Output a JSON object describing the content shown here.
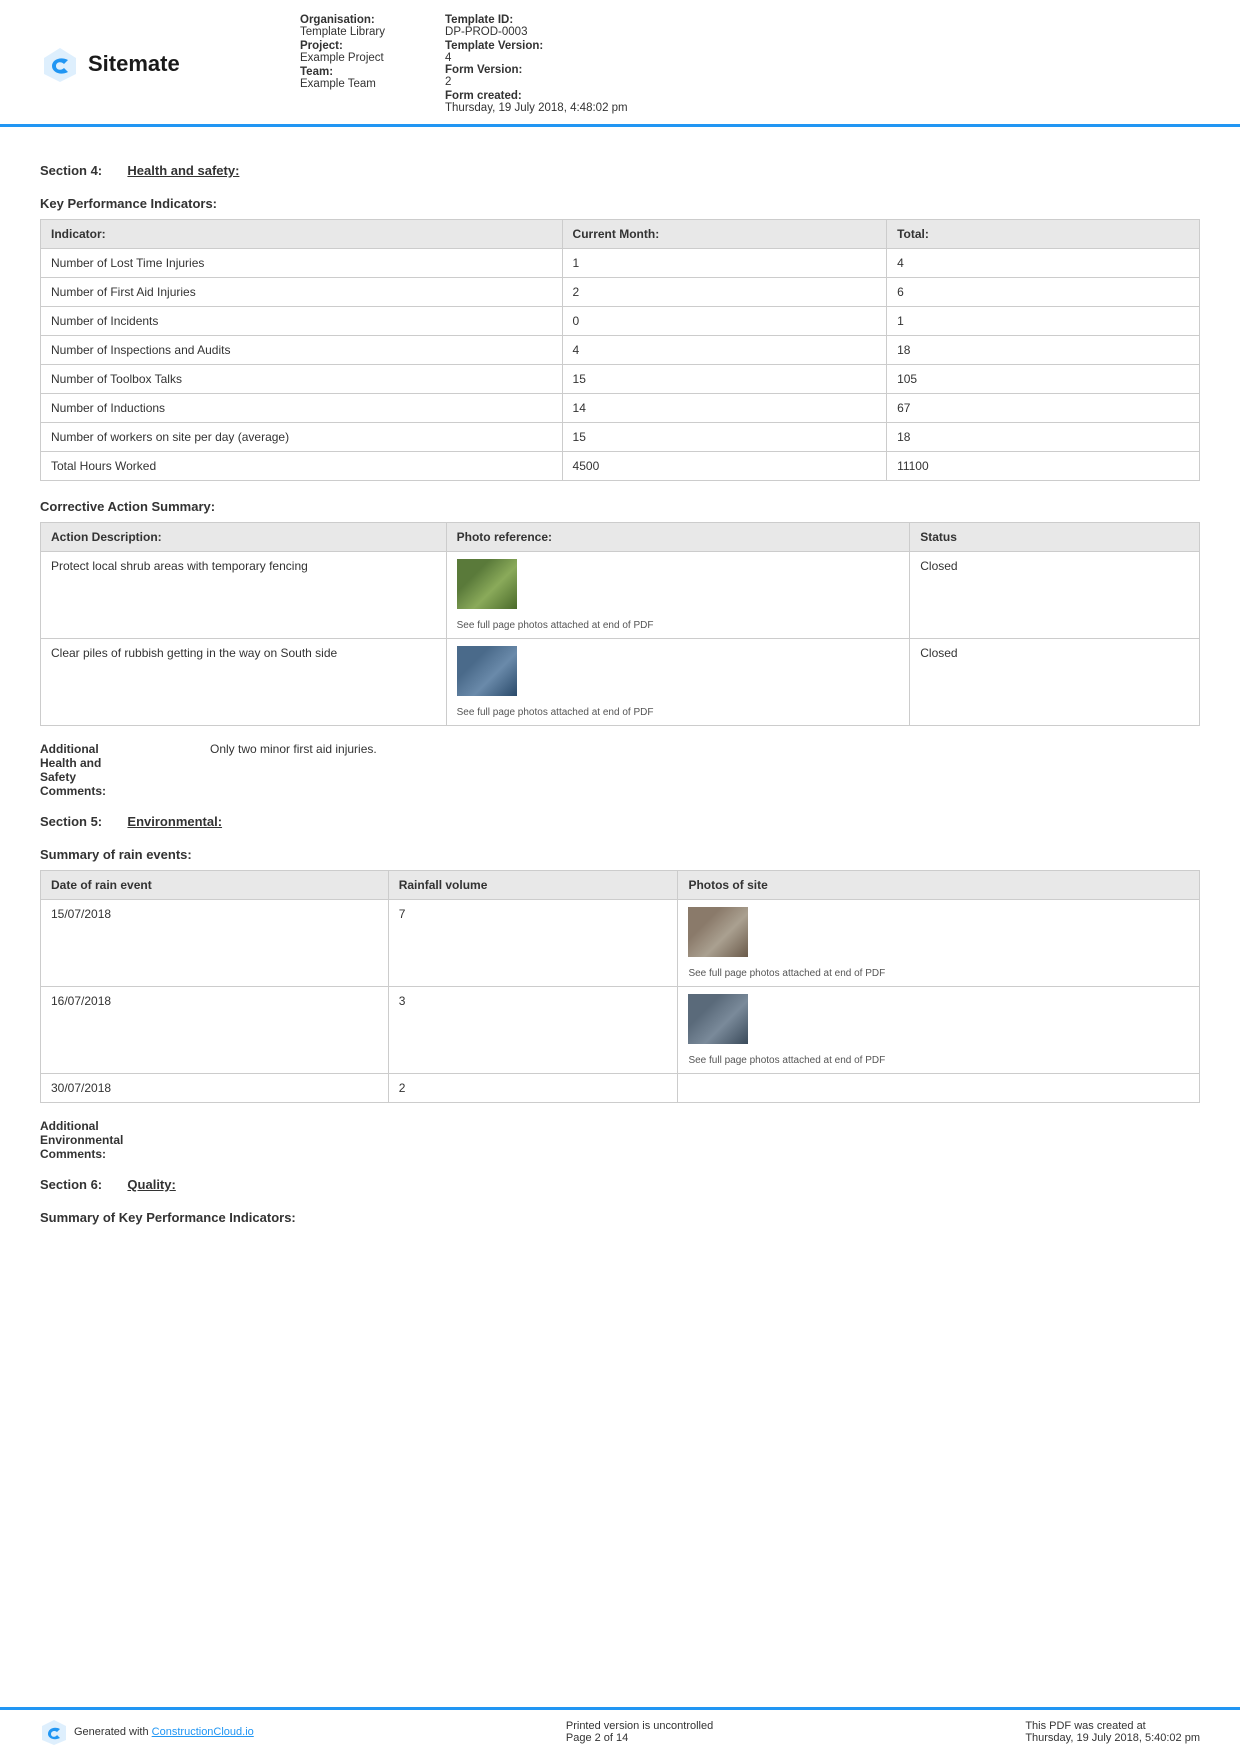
{
  "header": {
    "logo_text": "Sitemate",
    "org_label": "Organisation:",
    "org_value": "Template Library",
    "project_label": "Project:",
    "project_value": "Example Project",
    "team_label": "Team:",
    "team_value": "Example Team",
    "template_id_label": "Template ID:",
    "template_id_value": "DP-PROD-0003",
    "template_version_label": "Template Version:",
    "template_version_value": "4",
    "form_version_label": "Form Version:",
    "form_version_value": "2",
    "form_created_label": "Form created:",
    "form_created_value": "Thursday, 19 July 2018, 4:48:02 pm"
  },
  "section4": {
    "label": "Section 4:",
    "title": "Health and safety:"
  },
  "kpi": {
    "heading": "Key Performance Indicators:",
    "col_indicator": "Indicator:",
    "col_current_month": "Current Month:",
    "col_total": "Total:",
    "rows": [
      {
        "indicator": "Number of Lost Time Injuries",
        "current_month": "1",
        "total": "4"
      },
      {
        "indicator": "Number of First Aid Injuries",
        "current_month": "2",
        "total": "6"
      },
      {
        "indicator": "Number of Incidents",
        "current_month": "0",
        "total": "1"
      },
      {
        "indicator": "Number of Inspections and Audits",
        "current_month": "4",
        "total": "18"
      },
      {
        "indicator": "Number of Toolbox Talks",
        "current_month": "15",
        "total": "105"
      },
      {
        "indicator": "Number of Inductions",
        "current_month": "14",
        "total": "67"
      },
      {
        "indicator": "Number of workers on site per day (average)",
        "current_month": "15",
        "total": "18"
      },
      {
        "indicator": "Total Hours Worked",
        "current_month": "4500",
        "total": "11100"
      }
    ]
  },
  "corrective_action": {
    "heading": "Corrective Action Summary:",
    "col_action": "Action Description:",
    "col_photo": "Photo reference:",
    "col_status": "Status",
    "rows": [
      {
        "action": "Protect local shrub areas with temporary fencing",
        "photo_caption": "See full page photos attached at end of PDF",
        "photo_type": "shrub",
        "status": "Closed"
      },
      {
        "action": "Clear piles of rubbish getting in the way on South side",
        "photo_caption": "See full page photos attached at end of PDF",
        "photo_type": "rubbish",
        "status": "Closed"
      }
    ]
  },
  "additional_health": {
    "label": "Additional\nHealth and\nSafety\nComments:",
    "value": "Only two minor first aid injuries."
  },
  "section5": {
    "label": "Section 5:",
    "title": "Environmental:"
  },
  "rain_events": {
    "heading": "Summary of rain events:",
    "col_date": "Date of rain event",
    "col_rainfall": "Rainfall volume",
    "col_photos": "Photos of site",
    "rows": [
      {
        "date": "15/07/2018",
        "rainfall": "7",
        "photo_type": "rain1",
        "photo_caption": "See full page photos attached at end of PDF"
      },
      {
        "date": "16/07/2018",
        "rainfall": "3",
        "photo_type": "rain2",
        "photo_caption": "See full page photos attached at end of PDF"
      },
      {
        "date": "30/07/2018",
        "rainfall": "2",
        "photo_type": "",
        "photo_caption": ""
      }
    ]
  },
  "additional_env": {
    "label": "Additional\nEnvironmental\nComments:",
    "value": ""
  },
  "section6": {
    "label": "Section 6:",
    "title": "Quality:"
  },
  "section6_sub": {
    "heading": "Summary of Key Performance Indicators:"
  },
  "footer": {
    "generated_text": "Generated with",
    "link_text": "ConstructionCloud.io",
    "print_notice": "Printed version is uncontrolled",
    "page_info": "Page 2 of 14",
    "pdf_created_label": "This PDF was created at",
    "pdf_created_value": "Thursday, 19 July 2018, 5:40:02 pm"
  }
}
